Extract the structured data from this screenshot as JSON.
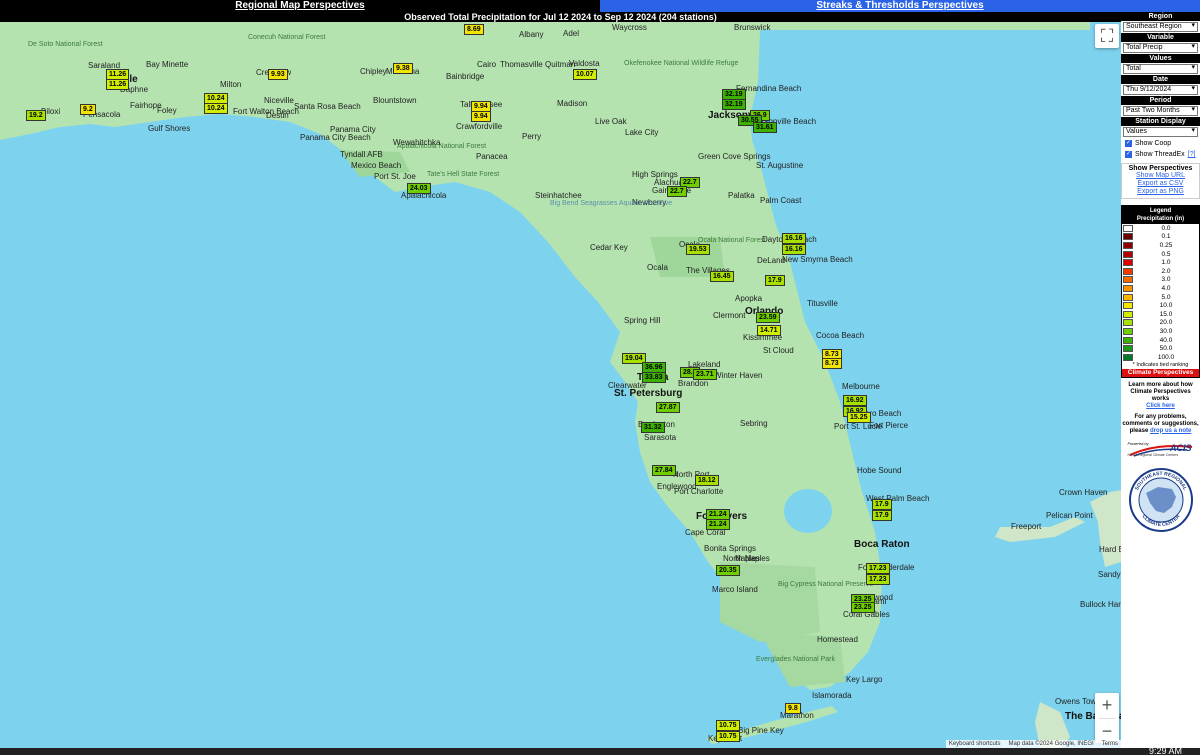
{
  "nav": {
    "left_tab": "Regional Map Perspectives",
    "right_tab": "Streaks & Thresholds Perspectives"
  },
  "title": "Observed Total Precipitation for Jul 12 2024 to Sep 12 2024 (204 stations)",
  "panel": {
    "region_label": "Region",
    "region_value": "Southeast Region",
    "variable_label": "Variable",
    "variable_value": "Total Precip",
    "values_label": "Values",
    "values_value": "Total",
    "date_label": "Date",
    "date_value": "Thu 9/12/2024",
    "period_label": "Period",
    "period_value": "Past Two Months",
    "station_display_label": "Station Display",
    "station_display_value": "Values",
    "show_coop": "Show Coop",
    "show_threadex": "Show ThreadEx",
    "threadex_help": "[?]",
    "perspectives_header": "Show Perspectives",
    "link_map_url": "Show Map URL",
    "link_csv": "Export as CSV",
    "link_png": "Export as PNG"
  },
  "legend": {
    "title_line1": "Legend",
    "title_line2": "Precipitation (in)",
    "items": [
      {
        "value": "0.0",
        "color": "#ffffff"
      },
      {
        "value": "0.1",
        "color": "#6b0000"
      },
      {
        "value": "0.25",
        "color": "#8b0000"
      },
      {
        "value": "0.5",
        "color": "#b30000"
      },
      {
        "value": "1.0",
        "color": "#dd0000"
      },
      {
        "value": "2.0",
        "color": "#f03a00"
      },
      {
        "value": "3.0",
        "color": "#f56a00"
      },
      {
        "value": "4.0",
        "color": "#f79400"
      },
      {
        "value": "5.0",
        "color": "#f8b800"
      },
      {
        "value": "10.0",
        "color": "#f2e600"
      },
      {
        "value": "15.0",
        "color": "#d2ee00"
      },
      {
        "value": "20.0",
        "color": "#a8e000"
      },
      {
        "value": "30.0",
        "color": "#6fcf00"
      },
      {
        "value": "40.0",
        "color": "#3db100"
      },
      {
        "value": "50.0",
        "color": "#1c9a1c"
      },
      {
        "value": "100.0",
        "color": "#067a2a"
      }
    ],
    "note": "* Indicates tied ranking"
  },
  "info": {
    "bar": "Climate Perspectives",
    "learn_line1": "Learn more about how",
    "learn_line2": "Climate Perspectives works",
    "learn_link": "Click here",
    "problems_line1": "For any problems,",
    "problems_line2": "comments or suggestions,",
    "problems_line3": "please",
    "problems_link": "drop us a note",
    "acis_powered": "Powered by",
    "acis_name": "ACIS",
    "acis_sub": "NOAA Regional Climate Centers",
    "seal_top": "SOUTHEAST REGIONAL",
    "seal_bottom": "CLIMATE CENTER"
  },
  "map": {
    "attribution_shortcuts": "Keyboard shortcuts",
    "attribution_data": "Map data ©2024 Google, INEGI",
    "attribution_terms": "Terms",
    "zoom_in": "+",
    "zoom_out": "−",
    "fullscreen": "⛶",
    "stations": [
      {
        "v": "8.69",
        "c": "#f2e600"
      },
      {
        "v": "11.26",
        "c": "#d2ee00"
      },
      {
        "v": "11.26",
        "c": "#d2ee00"
      },
      {
        "v": "9.93",
        "c": "#f2e600"
      },
      {
        "v": "9.38",
        "c": "#f2e600"
      },
      {
        "v": "10.07",
        "c": "#d2ee00"
      },
      {
        "v": "10.24",
        "c": "#d2ee00"
      },
      {
        "v": "10.24",
        "c": "#d2ee00"
      },
      {
        "v": "9.2",
        "c": "#f2e600"
      },
      {
        "v": "19.2",
        "c": "#a8e000"
      },
      {
        "v": "9.94",
        "c": "#f2e600"
      },
      {
        "v": "9.94",
        "c": "#f2e600"
      },
      {
        "v": "32.19",
        "c": "#3db100"
      },
      {
        "v": "32.19",
        "c": "#3db100"
      },
      {
        "v": "26.9",
        "c": "#6fcf00"
      },
      {
        "v": "30.55",
        "c": "#3db100"
      },
      {
        "v": "31.61",
        "c": "#3db100"
      },
      {
        "v": "24.03",
        "c": "#6fcf00"
      },
      {
        "v": "22.7",
        "c": "#6fcf00"
      },
      {
        "v": "22.7",
        "c": "#6fcf00"
      },
      {
        "v": "16.16",
        "c": "#a8e000"
      },
      {
        "v": "16.16",
        "c": "#a8e000"
      },
      {
        "v": "19.53",
        "c": "#a8e000"
      },
      {
        "v": "16.45",
        "c": "#a8e000"
      },
      {
        "v": "17.9",
        "c": "#a8e000"
      },
      {
        "v": "23.59",
        "c": "#6fcf00"
      },
      {
        "v": "14.71",
        "c": "#d2ee00"
      },
      {
        "v": "8.73",
        "c": "#f2e600"
      },
      {
        "v": "8.73",
        "c": "#f2e600"
      },
      {
        "v": "19.04",
        "c": "#a8e000"
      },
      {
        "v": "36.96",
        "c": "#3db100"
      },
      {
        "v": "33.83",
        "c": "#3db100"
      },
      {
        "v": "28.5",
        "c": "#6fcf00"
      },
      {
        "v": "23.71",
        "c": "#6fcf00"
      },
      {
        "v": "27.87",
        "c": "#6fcf00"
      },
      {
        "v": "31.32",
        "c": "#3db100"
      },
      {
        "v": "16.92",
        "c": "#a8e000"
      },
      {
        "v": "16.92",
        "c": "#a8e000"
      },
      {
        "v": "15.25",
        "c": "#d2ee00"
      },
      {
        "v": "27.84",
        "c": "#6fcf00"
      },
      {
        "v": "18.12",
        "c": "#a8e000"
      },
      {
        "v": "21.24",
        "c": "#6fcf00"
      },
      {
        "v": "21.24",
        "c": "#6fcf00"
      },
      {
        "v": "17.9",
        "c": "#a8e000"
      },
      {
        "v": "17.9",
        "c": "#a8e000"
      },
      {
        "v": "17.23",
        "c": "#a8e000"
      },
      {
        "v": "17.23",
        "c": "#a8e000"
      },
      {
        "v": "20.35",
        "c": "#6fcf00"
      },
      {
        "v": "23.25",
        "c": "#6fcf00"
      },
      {
        "v": "23.25",
        "c": "#6fcf00"
      },
      {
        "v": "9.8",
        "c": "#f2e600"
      },
      {
        "v": "10.75",
        "c": "#d2ee00"
      },
      {
        "v": "10.75",
        "c": "#d2ee00"
      }
    ],
    "labels": [
      "Waycross",
      "Brunswick",
      "De Soto National Forest",
      "Conecuh National Forest",
      "Albany",
      "Adel",
      "Okefenokee National Wildlife Refuge",
      "Saraland",
      "Mobile",
      "Bay Minette",
      "Crestview",
      "Chipley",
      "Marianna",
      "Bainbridge",
      "Cairo",
      "Thomasville",
      "Quitman",
      "Valdosta",
      "Fernandina Beach",
      "Daphne",
      "Milton",
      "Fairhope",
      "Foley",
      "Pensacola",
      "Biloxi",
      "Gulf Shores",
      "Niceville",
      "Destin",
      "Fort Walton Beach",
      "Santa Rosa Beach",
      "Blountstown",
      "Tallahassee",
      "Crawfordville",
      "Madison",
      "Live Oak",
      "Lake City",
      "Jacksonville",
      "Jacksonville Beach",
      "Panama City",
      "Panama City Beach",
      "Tyndall AFB",
      "Mexico Beach",
      "Port St. Joe",
      "Apalachicola National Forest",
      "Wewahitchka",
      "Perry",
      "Panacea",
      "Apalachicola",
      "Tate's Hell State Forest",
      "St. Augustine",
      "Green Cove Springs",
      "Palatka",
      "High Springs",
      "Alachua",
      "Gainesville",
      "Newberry",
      "Palm Coast",
      "Steinhatchee",
      "Big Bend Seagrasses Aquatic Preserve",
      "Cedar Key",
      "Ocala",
      "Ocala National Forest",
      "Daytona Beach",
      "New Smyrna Beach",
      "DeLand",
      "The Villages",
      "Apopka",
      "Titusville",
      "Orlando",
      "Clermont",
      "Kissimmee",
      "Cocoa Beach",
      "St Cloud",
      "Spring Hill",
      "Lakeland",
      "Winter Haven",
      "Clearwater",
      "St. Petersburg",
      "Tampa",
      "Brandon",
      "Bradenton",
      "Sarasota",
      "Sebring",
      "Melbourne",
      "Vero Beach",
      "Fort Pierce",
      "Port St. Lucie",
      "Hobe Sound",
      "Venice",
      "North Port",
      "Englewood",
      "Port Charlotte",
      "Fort Myers",
      "Cape Coral",
      "Bonita Springs",
      "Naples",
      "North Naples",
      "Marco Island",
      "Big Cypress National Preserve",
      "West Palm Beach",
      "Boca Raton",
      "Fort Lauderdale",
      "Hollywood",
      "Miami",
      "Coral Gables",
      "Homestead",
      "Everglades National Park",
      "Key Largo",
      "Islamorada",
      "Marathon",
      "Big Pine Key",
      "Key West",
      "Freeport",
      "Crown Haven",
      "Pelican Point",
      "Owens Town",
      "The Bahamas",
      "Hard Bay",
      "Bullock Harbour",
      "Sandy Point",
      "Ocala"
    ]
  },
  "clock": "9:29 AM"
}
